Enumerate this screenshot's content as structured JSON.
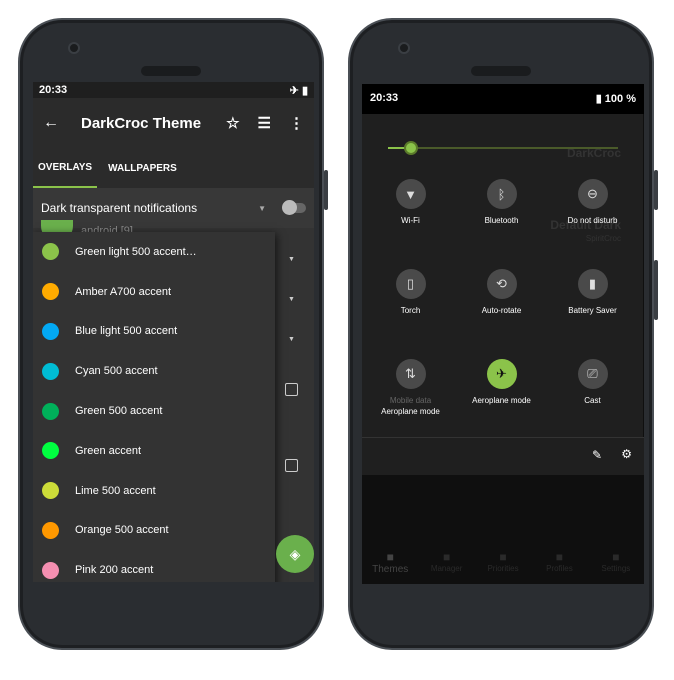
{
  "left": {
    "status": {
      "time": "20:33",
      "icons": [
        "airplane-icon",
        "battery-icon"
      ]
    },
    "toolbar": {
      "title": "DarkCroc Theme"
    },
    "tabs": [
      {
        "label": "OVERLAYS",
        "active": true
      },
      {
        "label": "WALLPAPERS",
        "active": false
      }
    ],
    "row": {
      "label": "Dark transparent notifications",
      "toggle_on": false
    },
    "behind": "android [9]",
    "menu": [
      {
        "label": "Green light 500 accent…",
        "color": "#8bc34a"
      },
      {
        "label": "Amber A700 accent",
        "color": "#ffab00"
      },
      {
        "label": "Blue light 500 accent",
        "color": "#03a9f4"
      },
      {
        "label": "Cyan 500 accent",
        "color": "#00bcd4"
      },
      {
        "label": "Green 500 accent",
        "color": "#00b05a"
      },
      {
        "label": "Green accent",
        "color": "#00ff40"
      },
      {
        "label": "Lime 500 accent",
        "color": "#cddc39"
      },
      {
        "label": "Orange 500 accent",
        "color": "#ff9800"
      },
      {
        "label": "Pink 200 accent",
        "color": "#f48fb1"
      }
    ],
    "accent": "#8bc34a"
  },
  "right": {
    "status": {
      "time": "20:33",
      "battery": "100 %"
    },
    "brightness": 0.1,
    "tiles": [
      {
        "label": "Wi-Fi",
        "icon": "wifi-icon"
      },
      {
        "label": "Bluetooth",
        "icon": "bluetooth-icon"
      },
      {
        "label": "Do not disturb",
        "icon": "do-not-disturb-icon"
      },
      {
        "label": "Torch",
        "icon": "torch-icon"
      },
      {
        "label": "Auto-rotate",
        "icon": "auto-rotate-icon"
      },
      {
        "label": "Battery Saver",
        "icon": "battery-saver-icon"
      },
      {
        "label": "Mobile data",
        "sub": "Aeroplane mode",
        "icon": "mobile-data-icon"
      },
      {
        "label": "Aeroplane mode",
        "icon": "airplane-icon",
        "active": true
      },
      {
        "label": "Cast",
        "icon": "cast-icon"
      }
    ],
    "behind": {
      "t1": "DarkCroc",
      "t1sub": "SpiritCroc",
      "t2": "Default Dark",
      "t2sub": "SpiritCroc"
    },
    "nav": [
      "Themes",
      "Manager",
      "Priorities",
      "Profiles",
      "Settings"
    ]
  }
}
